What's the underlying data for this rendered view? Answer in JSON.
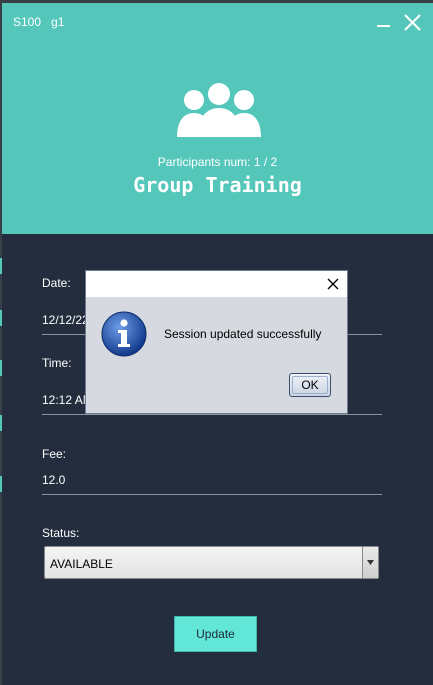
{
  "header": {
    "session_id": "S100",
    "group_id": "g1",
    "participants": "Participants num: 1 / 2",
    "title": "Group Training",
    "icon": "group-icon",
    "background_color": "#54c6ba"
  },
  "window_controls": {
    "minimize_icon": "minimize-icon",
    "close_icon": "close-icon"
  },
  "form": {
    "date_label": "Date:",
    "date_value": "12/12/22",
    "time_label": "Time:",
    "time_value": "12:12 AM",
    "fee_label": "Fee:",
    "fee_value": "12.0",
    "status_label": "Status:",
    "status_value": "AVAILABLE",
    "update_label": "Update"
  },
  "dialog": {
    "message": "Session updated successfully",
    "ok_label": "OK",
    "icon": "info-icon"
  },
  "colors": {
    "panel": "#232d3d",
    "accent": "#54c6ba",
    "button": "#62e6d8"
  }
}
